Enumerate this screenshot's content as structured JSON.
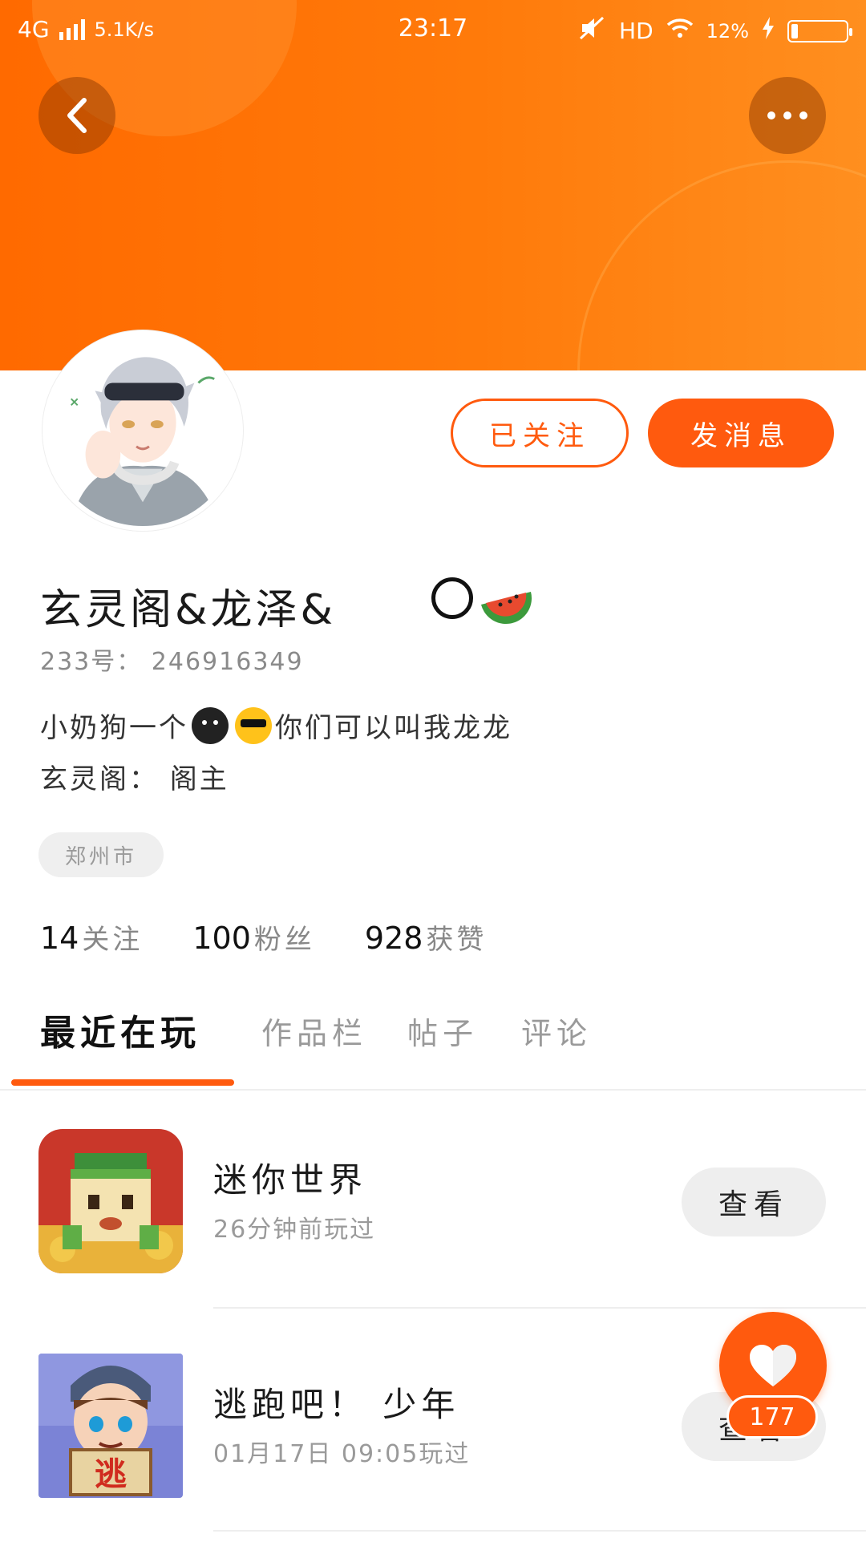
{
  "status_bar": {
    "network": "4G",
    "speed": "5.1K/s",
    "time": "23:17",
    "hd": "HD",
    "battery": "12%"
  },
  "header": {
    "back_icon": "chevron-left-icon",
    "more_icon": "more-dots-icon",
    "color": "#ff6a00"
  },
  "profile": {
    "username": "玄灵阁&龙泽&",
    "user_id": "233号：  246916349",
    "bio_part1": "小奶狗一个",
    "bio_part2": "你们可以叫我龙龙",
    "bio_line2": "玄灵阁：  阁主",
    "location": "郑州市"
  },
  "actions": {
    "follow_label": "已关注",
    "message_label": "发消息",
    "accent": "#ff5a0e"
  },
  "stats": [
    {
      "num": "14",
      "label": "关注"
    },
    {
      "num": "100",
      "label": "粉丝"
    },
    {
      "num": "928",
      "label": "获赞"
    }
  ],
  "tabs": [
    "最近在玩",
    "作品栏",
    "帖子",
    "评论"
  ],
  "games": [
    {
      "name": "迷你世界",
      "time": "26分钟前玩过",
      "button": "查看"
    },
    {
      "name": "逃跑吧！ 少年",
      "time": "01月17日  09:05玩过",
      "button": "查看"
    }
  ],
  "like": {
    "count": "177"
  }
}
